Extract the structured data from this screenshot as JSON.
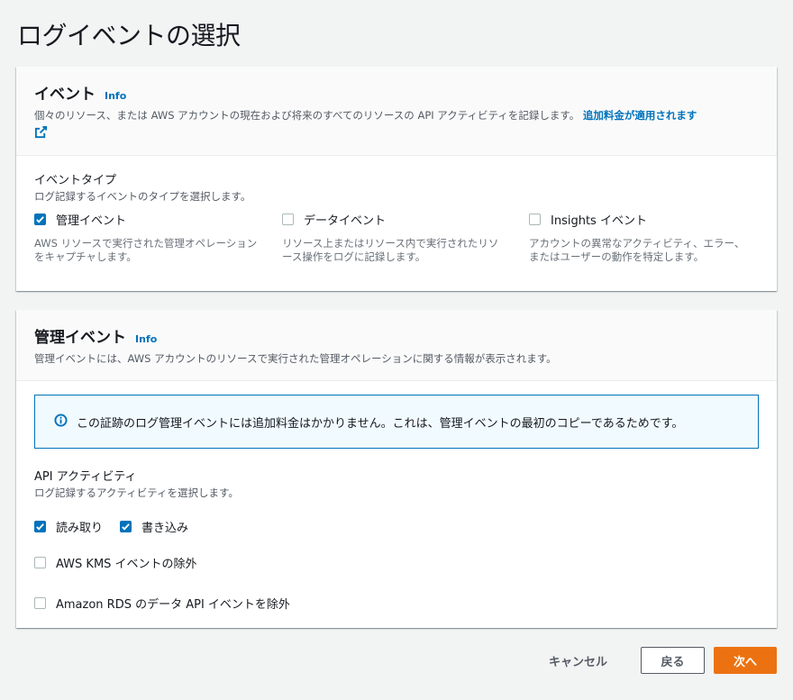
{
  "page": {
    "title": "ログイベントの選択"
  },
  "events_panel": {
    "title": "イベント",
    "info": "Info",
    "description": "個々のリソース、または AWS アカウントの現在および将来のすべてのリソースの API アクティビティを記録します。",
    "charge_link": "追加料金が適用されます",
    "event_type_label": "イベントタイプ",
    "event_type_desc": "ログ記録するイベントのタイプを選択します。",
    "options": [
      {
        "label": "管理イベント",
        "checked": true,
        "desc": "AWS リソースで実行された管理オペレーションをキャプチャします。"
      },
      {
        "label": "データイベント",
        "checked": false,
        "desc": "リソース上またはリソース内で実行されたリソース操作をログに記録します。"
      },
      {
        "label": "Insights イベント",
        "checked": false,
        "desc": "アカウントの異常なアクティビティ、エラー、またはユーザーの動作を特定します。"
      }
    ]
  },
  "mgmt_panel": {
    "title": "管理イベント",
    "info": "Info",
    "description": "管理イベントには、AWS アカウントのリソースで実行された管理オペレーションに関する情報が表示されます。",
    "info_box": "この証跡のログ管理イベントには追加料金はかかりません。これは、管理イベントの最初のコピーであるためです。",
    "api_label": "API アクティビティ",
    "api_desc": "ログ記録するアクティビティを選択します。",
    "read_label": "読み取り",
    "read_checked": true,
    "write_label": "書き込み",
    "write_checked": true,
    "kms_label": "AWS KMS イベントの除外",
    "kms_checked": false,
    "rds_label": "Amazon RDS のデータ API イベントを除外",
    "rds_checked": false
  },
  "footer": {
    "cancel": "キャンセル",
    "back": "戻る",
    "next": "次へ"
  },
  "colors": {
    "accent": "#0073bb",
    "primary_button": "#ec7211",
    "info_bg": "#f1faff"
  }
}
